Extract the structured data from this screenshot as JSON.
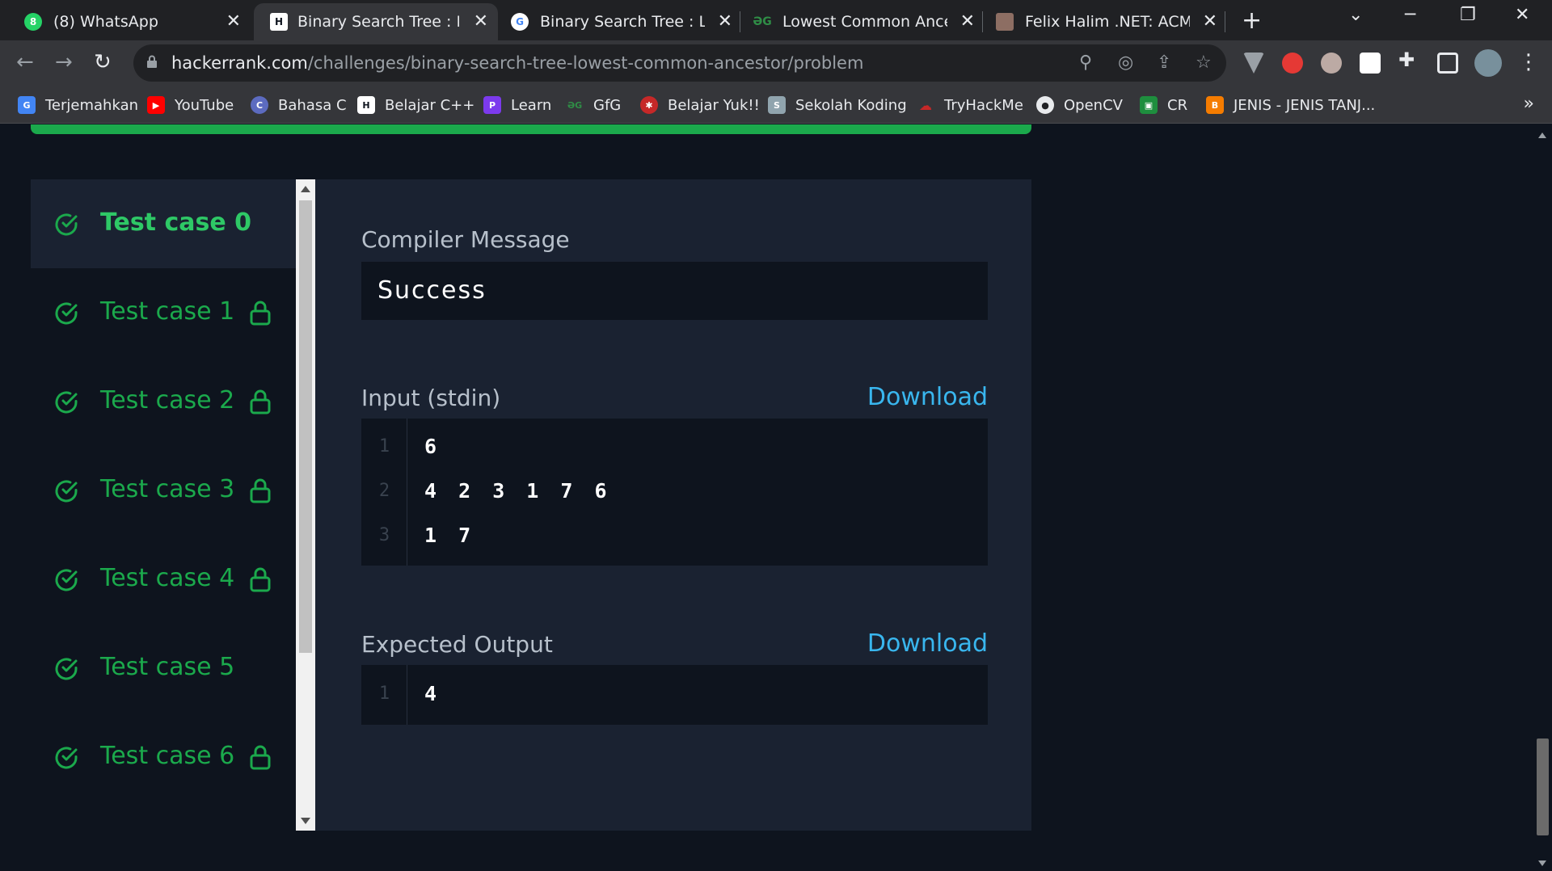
{
  "tabs": [
    {
      "title": "(8) WhatsApp",
      "icon": "whatsapp-icon"
    },
    {
      "title": "Binary Search Tree : Lowes",
      "icon": "hackerrank-icon",
      "active": true
    },
    {
      "title": "Binary Search Tree : Lowe",
      "icon": "google-icon"
    },
    {
      "title": "Lowest Common Ancesto",
      "icon": "gfg-icon"
    },
    {
      "title": "Felix Halim .NET: ACM ICP",
      "icon": "profile-photo-icon"
    }
  ],
  "address_bar": {
    "host": "hackerrank.com",
    "path": "/challenges/binary-search-tree-lowest-common-ancestor/problem"
  },
  "bookmarks": [
    {
      "label": "Terjemahkan",
      "icon": "google-translate-icon",
      "color": "#4285f4"
    },
    {
      "label": "YouTube",
      "icon": "youtube-icon",
      "color": "#ff0000"
    },
    {
      "label": "Bahasa C",
      "icon": "c-lang-icon",
      "color": "#5c6bc0"
    },
    {
      "label": "Belajar C++",
      "icon": "hackerrank-icon",
      "color": "#0e141e"
    },
    {
      "label": "Learn",
      "icon": "learn-icon",
      "color": "#7c3aed"
    },
    {
      "label": "GfG",
      "icon": "gfg-icon",
      "color": "#2f8d46"
    },
    {
      "label": "Belajar Yuk!!",
      "icon": "gear-red-icon",
      "color": "#c62828"
    },
    {
      "label": "Sekolah Koding",
      "icon": "sekolah-koding-icon",
      "color": "#90a4ae"
    },
    {
      "label": "TryHackMe",
      "icon": "tryhackme-icon",
      "color": "#c62828"
    },
    {
      "label": "OpenCV",
      "icon": "github-icon",
      "color": "#e8eaed"
    },
    {
      "label": "CR",
      "icon": "classroom-icon",
      "color": "#1e8e3e"
    },
    {
      "label": "JENIS - JENIS TANJ...",
      "icon": "blogger-icon",
      "color": "#f57c00"
    }
  ],
  "test_cases": [
    {
      "label": "Test case 0",
      "selected": true,
      "locked": false
    },
    {
      "label": "Test case 1",
      "selected": false,
      "locked": true
    },
    {
      "label": "Test case 2",
      "selected": false,
      "locked": true
    },
    {
      "label": "Test case 3",
      "selected": false,
      "locked": true
    },
    {
      "label": "Test case 4",
      "selected": false,
      "locked": true
    },
    {
      "label": "Test case 5",
      "selected": false,
      "locked": false
    },
    {
      "label": "Test case 6",
      "selected": false,
      "locked": true
    }
  ],
  "compiler": {
    "title": "Compiler Message",
    "message": "Success"
  },
  "input": {
    "title": "Input (stdin)",
    "download_label": "Download",
    "lines": [
      {
        "num": "1",
        "text": "6"
      },
      {
        "num": "2",
        "text": "4 2 3 1 7 6"
      },
      {
        "num": "3",
        "text": "1 7"
      }
    ]
  },
  "expected": {
    "title": "Expected Output",
    "download_label": "Download",
    "lines": [
      {
        "num": "1",
        "text": "4"
      }
    ]
  },
  "colors": {
    "success_green": "#1ba94c",
    "link_blue": "#39b6ee",
    "background": "#0e141e",
    "panel": "#1a2231"
  }
}
